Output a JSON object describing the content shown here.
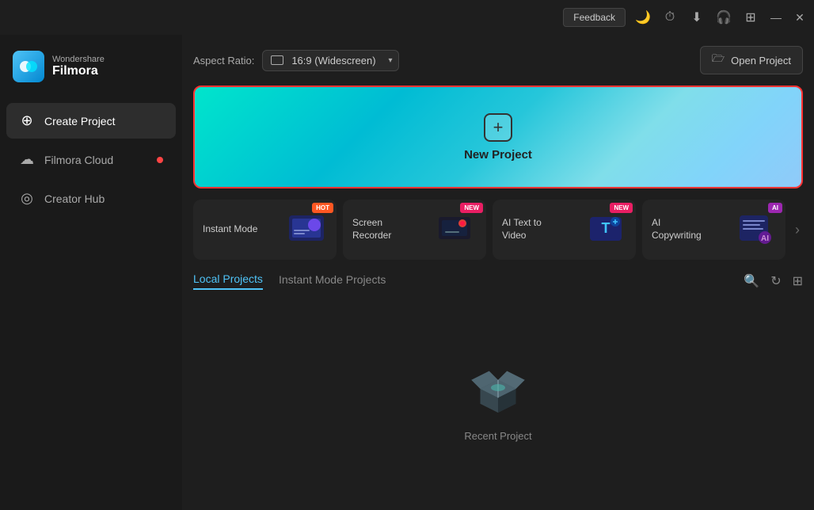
{
  "titlebar": {
    "feedback_label": "Feedback",
    "minimize_label": "—",
    "close_label": "✕"
  },
  "sidebar": {
    "brand_top": "Wondershare",
    "brand_name": "Filmora",
    "nav_items": [
      {
        "id": "create-project",
        "label": "Create Project",
        "icon": "⊕",
        "active": true
      },
      {
        "id": "filmora-cloud",
        "label": "Filmora Cloud",
        "icon": "☁",
        "active": false,
        "badge": true
      },
      {
        "id": "creator-hub",
        "label": "Creator Hub",
        "icon": "◎",
        "active": false
      }
    ]
  },
  "topbar": {
    "aspect_ratio_label": "Aspect Ratio:",
    "aspect_ratio_value": "16:9 (Widescreen)",
    "open_project_label": "Open Project"
  },
  "new_project": {
    "label": "New Project"
  },
  "feature_cards": [
    {
      "id": "instant-mode",
      "label": "Instant Mode",
      "badge": "HOT",
      "badge_type": "hot"
    },
    {
      "id": "screen-recorder",
      "label": "Screen Recorder",
      "badge": "NEW",
      "badge_type": "new"
    },
    {
      "id": "ai-text-to-video",
      "label": "AI Text to Video",
      "badge": "NEW",
      "badge_type": "new"
    },
    {
      "id": "ai-copywriting",
      "label": "AI Copywriting",
      "badge": "AI",
      "badge_type": "ai"
    }
  ],
  "projects": {
    "local_tab": "Local Projects",
    "instant_tab": "Instant Mode Projects",
    "empty_label": "Recent Project"
  }
}
